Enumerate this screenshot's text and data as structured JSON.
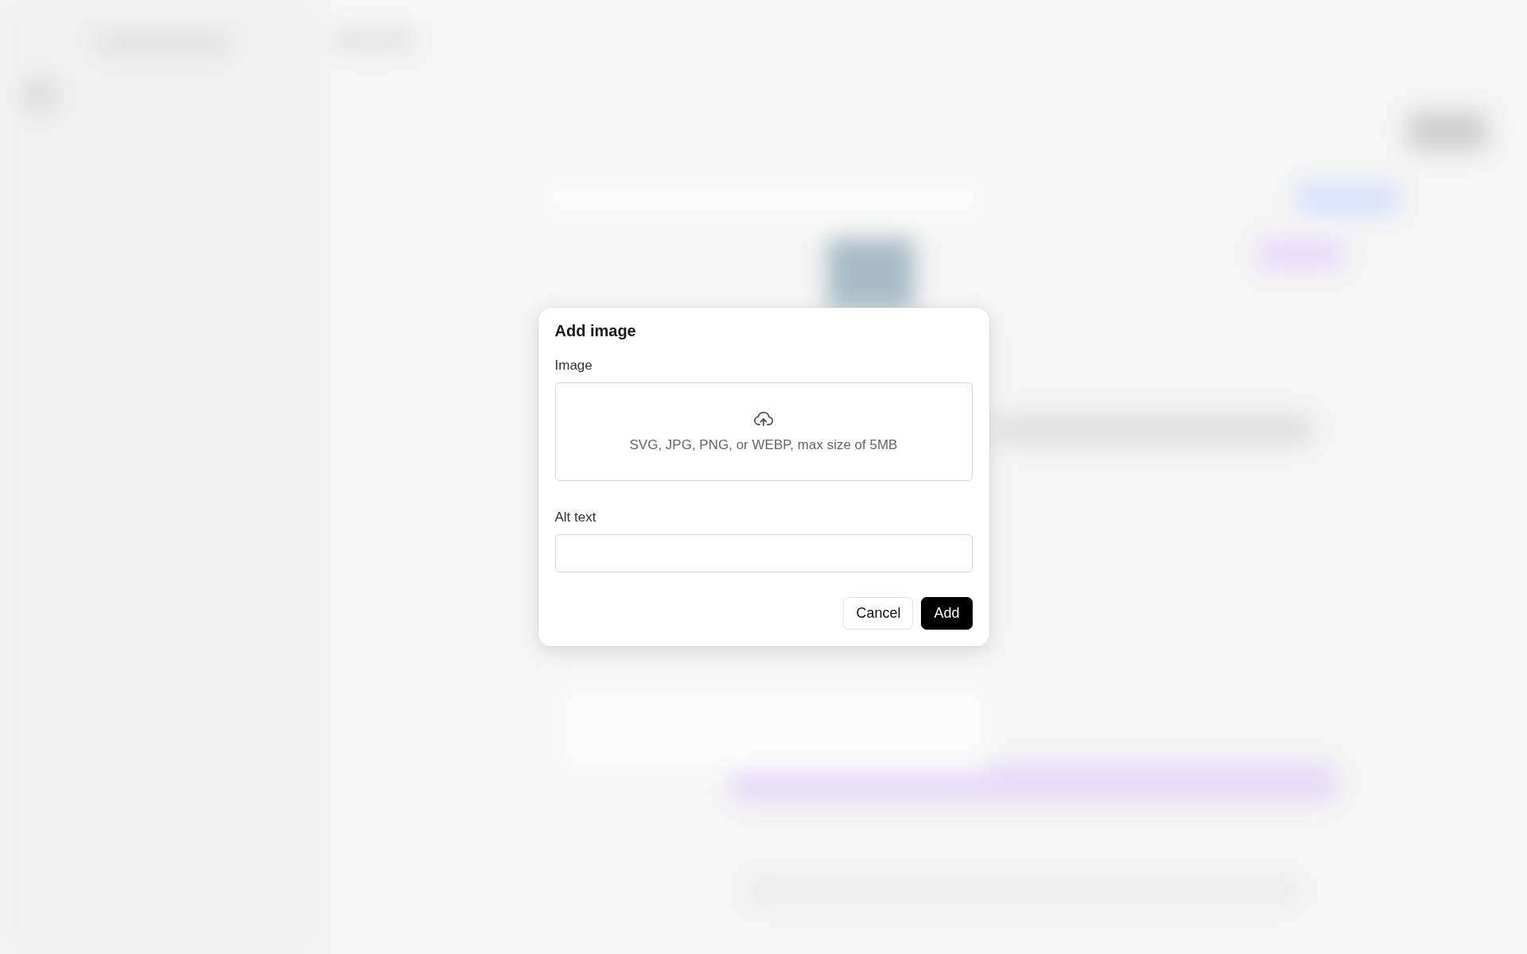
{
  "dialog": {
    "title": "Add image",
    "image_field": {
      "label": "Image",
      "hint": "SVG, JPG, PNG, or WEBP, max size of 5MB"
    },
    "alt_text_field": {
      "label": "Alt text"
    },
    "buttons": [
      {
        "label": "Cancel",
        "kind": "secondary"
      },
      {
        "label": "Add",
        "kind": "primary"
      }
    ]
  }
}
